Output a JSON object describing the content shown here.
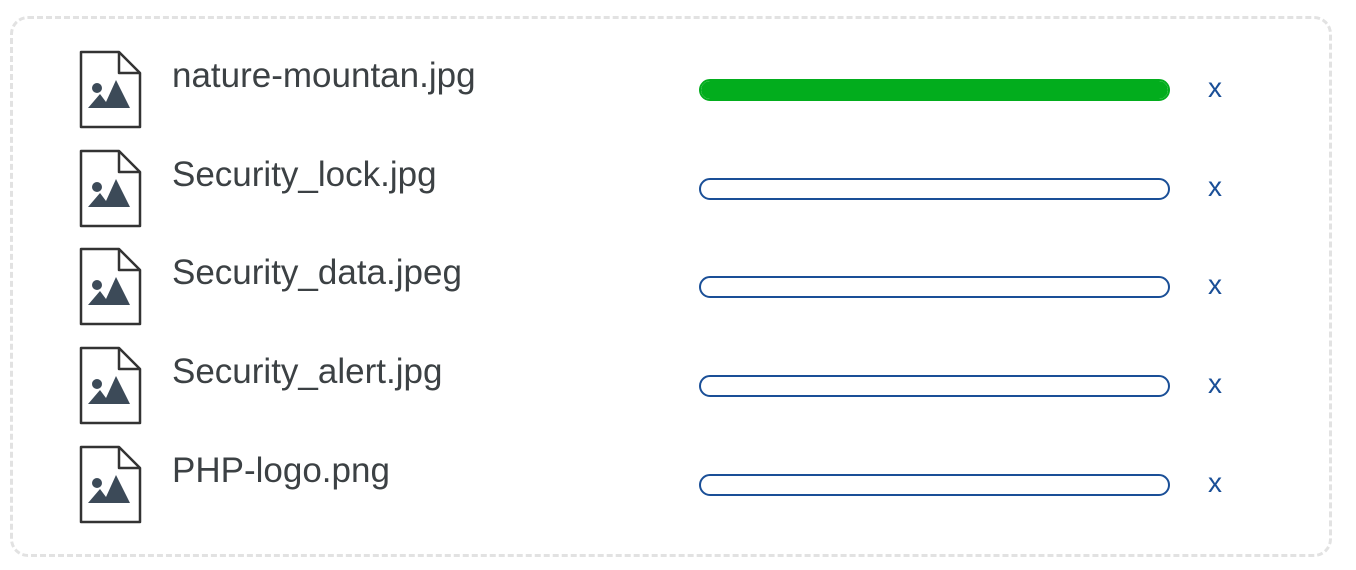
{
  "files": [
    {
      "name": "nature-mountan.jpg",
      "progress": 1.0,
      "remove_label": "x",
      "icon": "image-file-icon"
    },
    {
      "name": "Security_lock.jpg",
      "progress": 0.0,
      "remove_label": "x",
      "icon": "image-file-icon"
    },
    {
      "name": "Security_data.jpeg",
      "progress": 0.0,
      "remove_label": "x",
      "icon": "image-file-icon"
    },
    {
      "name": "Security_alert.jpg",
      "progress": 0.0,
      "remove_label": "x",
      "icon": "image-file-icon"
    },
    {
      "name": "PHP-logo.png",
      "progress": 0.0,
      "remove_label": "x",
      "icon": "image-file-icon"
    }
  ],
  "colors": {
    "progress_complete": "#02ad1d",
    "progress_border": "#1a4f97",
    "remove_link": "#1a4f97",
    "text": "#3c4144",
    "panel_border": "#e2e2e2"
  }
}
